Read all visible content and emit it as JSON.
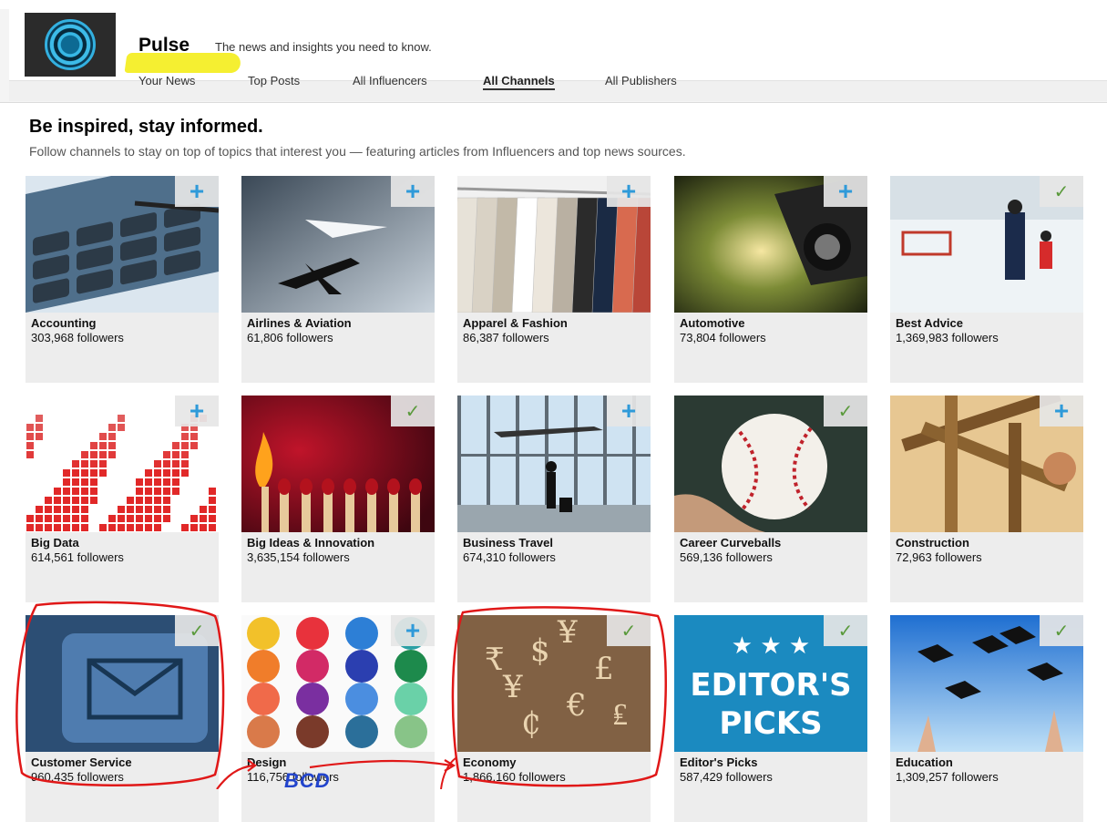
{
  "header": {
    "brand": "Pulse",
    "tagline": "The news and insights you need to know.",
    "nav": [
      {
        "label": "Your News"
      },
      {
        "label": "Top Posts"
      },
      {
        "label": "All Influencers"
      },
      {
        "label": "All Channels"
      },
      {
        "label": "All Publishers"
      }
    ],
    "active_nav": "All Channels"
  },
  "main": {
    "headline": "Be inspired, stay informed.",
    "subhead": "Follow channels to stay on top of topics that interest you — featuring articles from Influencers and top news sources."
  },
  "channels": [
    {
      "title": "Accounting",
      "followers": "303,968 followers",
      "state": "plus",
      "icon": "calculator-image"
    },
    {
      "title": "Airlines & Aviation",
      "followers": "61,806 followers",
      "state": "plus",
      "icon": "paper-plane-image"
    },
    {
      "title": "Apparel & Fashion",
      "followers": "86,387 followers",
      "state": "plus",
      "icon": "clothes-rack-image"
    },
    {
      "title": "Automotive",
      "followers": "73,804 followers",
      "state": "plus",
      "icon": "car-motion-image"
    },
    {
      "title": "Best Advice",
      "followers": "1,369,983 followers",
      "state": "check",
      "icon": "hockey-coach-image"
    },
    {
      "title": "Big Data",
      "followers": "614,561 followers",
      "state": "plus",
      "icon": "pixel-grid-image"
    },
    {
      "title": "Big Ideas & Innovation",
      "followers": "3,635,154 followers",
      "state": "check",
      "icon": "matches-image"
    },
    {
      "title": "Business Travel",
      "followers": "674,310 followers",
      "state": "plus",
      "icon": "airport-traveler-image"
    },
    {
      "title": "Career Curveballs",
      "followers": "569,136 followers",
      "state": "check",
      "icon": "baseball-image"
    },
    {
      "title": "Construction",
      "followers": "72,963 followers",
      "state": "plus",
      "icon": "timber-frame-image"
    },
    {
      "title": "Customer Service",
      "followers": "960,435 followers",
      "state": "check",
      "icon": "envelope-key-image"
    },
    {
      "title": "Design",
      "followers": "116,756 followers",
      "state": "plus",
      "icon": "watercolor-palette-image"
    },
    {
      "title": "Economy",
      "followers": "1,866,160 followers",
      "state": "check",
      "icon": "currency-symbols-image"
    },
    {
      "title": "Editor's Picks",
      "followers": "587,429 followers",
      "state": "check",
      "icon": "editors-picks-image",
      "image_text": [
        "EDITOR'S",
        "PICKS"
      ]
    },
    {
      "title": "Education",
      "followers": "1,309,257 followers",
      "state": "check",
      "icon": "graduation-caps-image"
    }
  ],
  "button_glyphs": {
    "plus": "+",
    "check": "✓"
  },
  "annotation": {
    "label": "BCD"
  },
  "colors": {
    "accent_blue": "#2f9ad9",
    "check_green": "#5a9a3c",
    "annotation_red": "#e01818",
    "highlight_yellow": "#f4ee26"
  }
}
